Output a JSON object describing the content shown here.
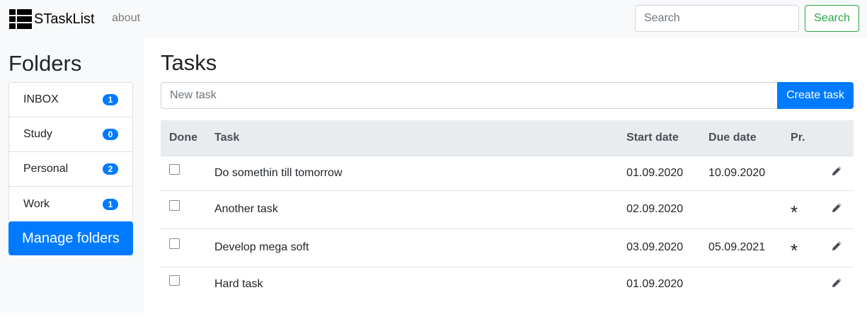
{
  "navbar": {
    "brand_icon": "list-icon",
    "brand": "STaskList",
    "about": "about",
    "search_placeholder": "Search",
    "search_button": "Search"
  },
  "sidebar": {
    "title": "Folders",
    "folders": [
      {
        "name": "INBOX",
        "count": "1"
      },
      {
        "name": "Study",
        "count": "0"
      },
      {
        "name": "Personal",
        "count": "2"
      },
      {
        "name": "Work",
        "count": "1"
      }
    ],
    "manage_button": "Manage folders"
  },
  "main": {
    "title": "Tasks",
    "new_task_placeholder": "New task",
    "create_button": "Create task",
    "columns": {
      "done": "Done",
      "task": "Task",
      "start": "Start date",
      "due": "Due date",
      "priority": "Pr."
    },
    "tasks": [
      {
        "done": false,
        "task": "Do somethin till tomorrow",
        "start": "01.09.2020",
        "due": "10.09.2020",
        "priority": ""
      },
      {
        "done": false,
        "task": "Another task",
        "start": "02.09.2020",
        "due": "",
        "priority": "*"
      },
      {
        "done": false,
        "task": "Develop mega soft",
        "start": "03.09.2020",
        "due": "05.09.2021",
        "priority": "*"
      },
      {
        "done": false,
        "task": "Hard task",
        "start": "01.09.2020",
        "due": "",
        "priority": ""
      }
    ],
    "row_action_icon": "pencil-icon"
  },
  "colors": {
    "primary": "#007bff",
    "success": "#28a745",
    "navbar_bg": "#f8f9fa",
    "table_head_bg": "#e9ecef",
    "muted": "#6c757d"
  }
}
